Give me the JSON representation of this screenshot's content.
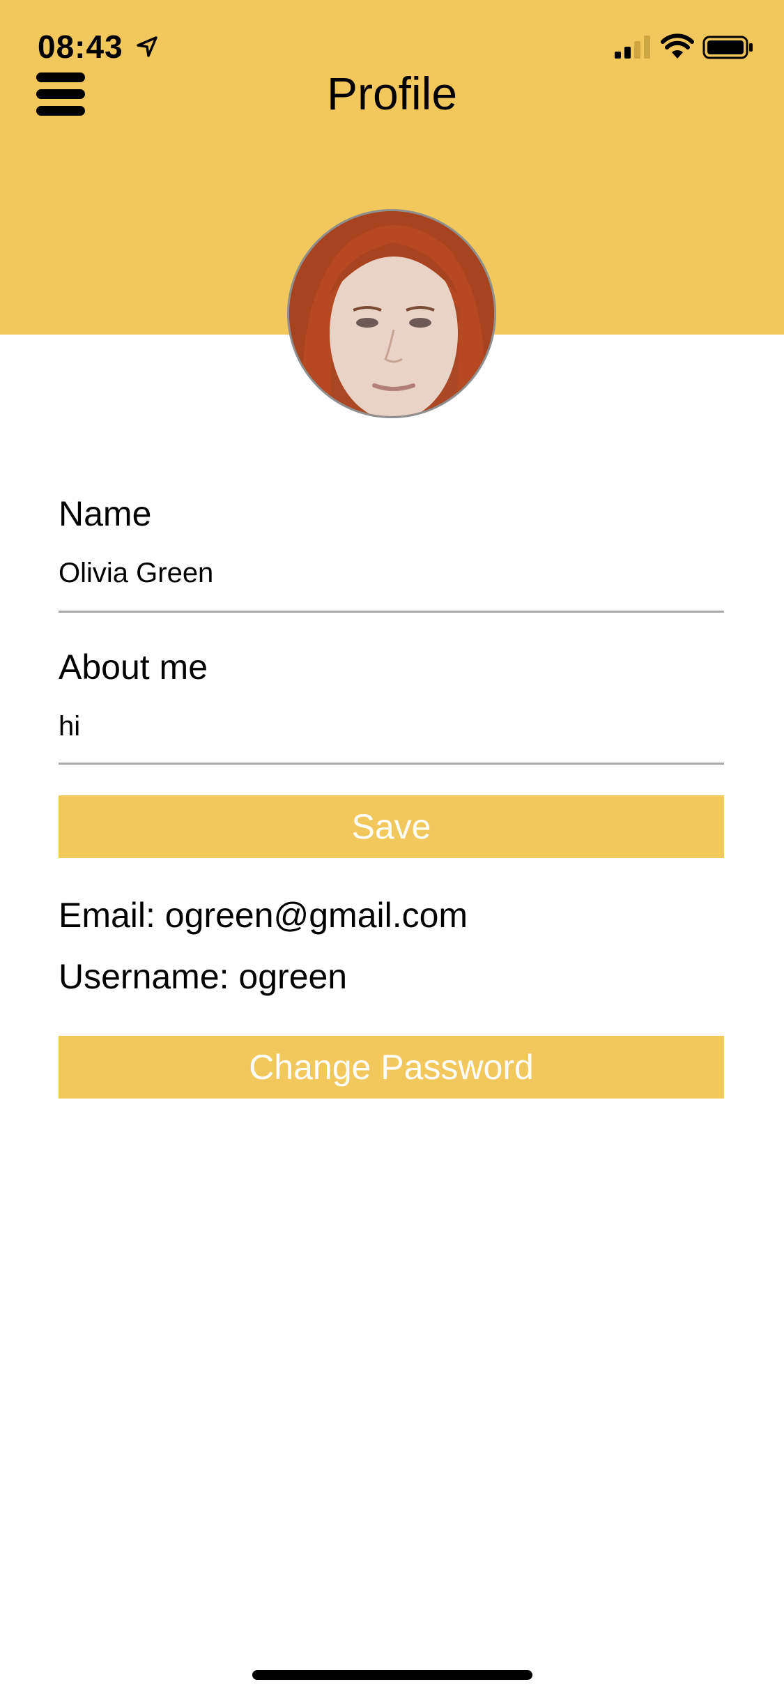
{
  "status_bar": {
    "time": "08:43",
    "icons": [
      "location-arrow-icon",
      "cellular-signal-icon",
      "wifi-icon",
      "battery-icon"
    ]
  },
  "header": {
    "title": "Profile",
    "menu_icon": "hamburger-menu-icon",
    "background_color": "#F2C75C"
  },
  "profile": {
    "avatar": "profile-photo"
  },
  "form": {
    "name_label": "Name",
    "name_value": "Olivia Green",
    "about_label": "About me",
    "about_value": "hi",
    "save_label": "Save"
  },
  "account": {
    "email_text": "Email: ogreen@gmail.com",
    "username_text": "Username: ogreen",
    "change_password_label": "Change Password"
  },
  "colors": {
    "accent": "#F2C75C",
    "button_text": "#FFFFFF",
    "divider": "#A9A9A9"
  }
}
